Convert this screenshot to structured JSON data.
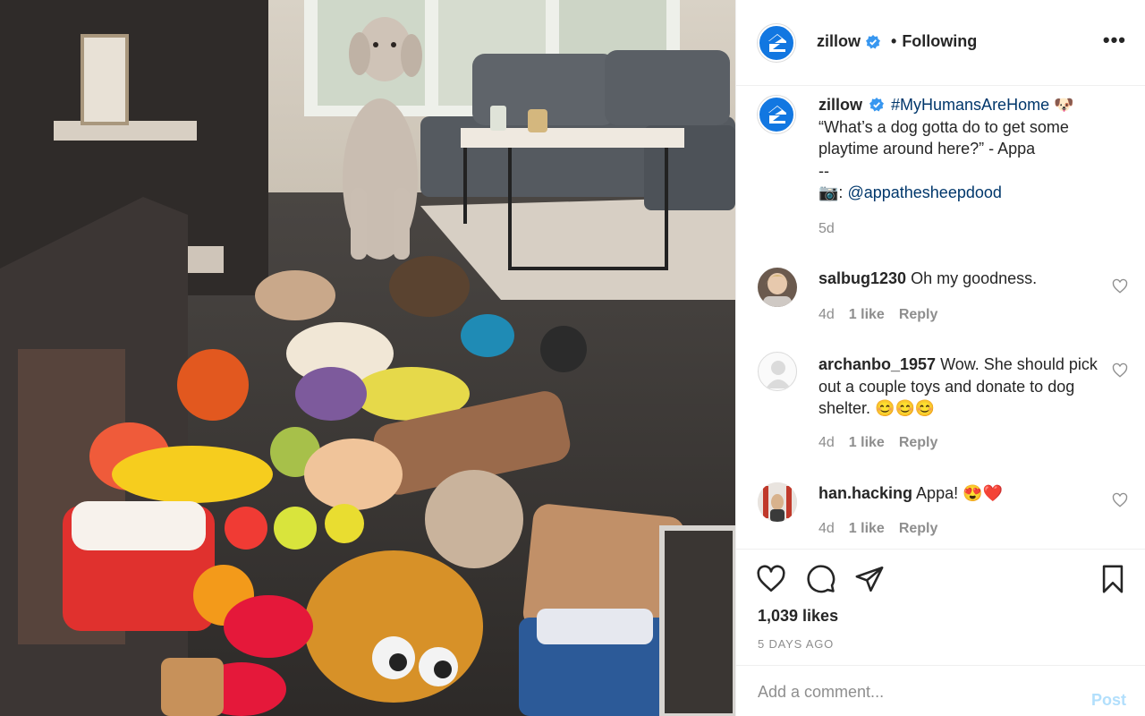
{
  "post": {
    "account": "zillow",
    "follow_status": "Following",
    "separator": "•",
    "more_icon": "more-horizontal-icon",
    "caption": {
      "username": "zillow",
      "hashtag": "#MyHumansAreHome",
      "hashtag_emoji": "🐶",
      "line1": "“What’s a dog gotta do to get some playtime around here?” - Appa",
      "line2": "--",
      "camera_emoji": "📷",
      "colon": ":",
      "mention": "@appathesheepdood",
      "age": "5d"
    },
    "comments": [
      {
        "username": "salbug1230",
        "text": "Oh my goodness.",
        "age": "4d",
        "likes": "1 like",
        "reply": "Reply"
      },
      {
        "username": "archanbo_1957",
        "text": "Wow. She should pick out a couple toys and donate to dog shelter. 😊😊😊",
        "age": "4d",
        "likes": "1 like",
        "reply": "Reply"
      },
      {
        "username": "han.hacking",
        "text": "Appa! 😍❤️",
        "age": "4d",
        "likes": "1 like",
        "reply": "Reply"
      }
    ],
    "likes_count": "1,039 likes",
    "date": "5 DAYS AGO",
    "add_comment_placeholder": "Add a comment...",
    "post_button": "Post"
  },
  "colors": {
    "zillow_blue": "#1277e1",
    "verified_blue": "#3897f0",
    "link_blue": "#00376b",
    "muted_gray": "#8e8e8e",
    "post_disabled": "#b2dffc"
  }
}
